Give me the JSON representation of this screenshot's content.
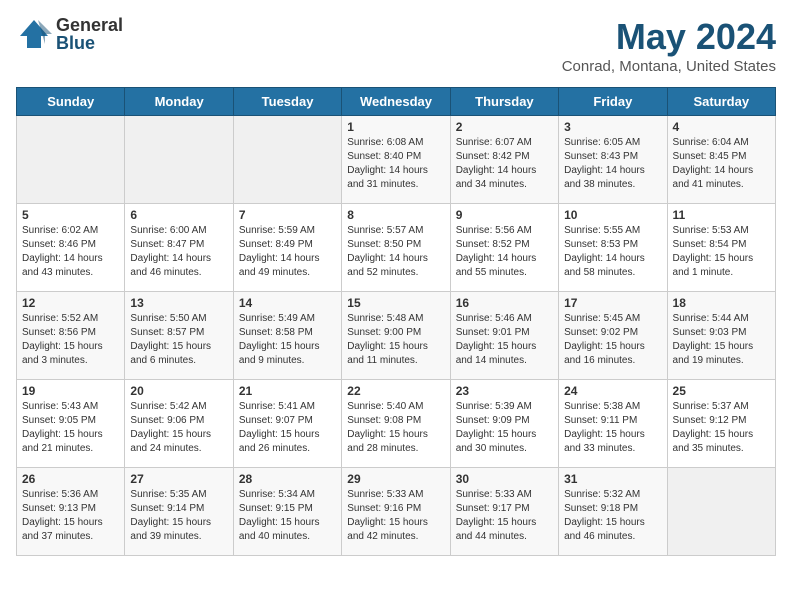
{
  "logo": {
    "general": "General",
    "blue": "Blue"
  },
  "title": "May 2024",
  "subtitle": "Conrad, Montana, United States",
  "days_header": [
    "Sunday",
    "Monday",
    "Tuesday",
    "Wednesday",
    "Thursday",
    "Friday",
    "Saturday"
  ],
  "weeks": [
    [
      {
        "num": "",
        "info": ""
      },
      {
        "num": "",
        "info": ""
      },
      {
        "num": "",
        "info": ""
      },
      {
        "num": "1",
        "info": "Sunrise: 6:08 AM\nSunset: 8:40 PM\nDaylight: 14 hours\nand 31 minutes."
      },
      {
        "num": "2",
        "info": "Sunrise: 6:07 AM\nSunset: 8:42 PM\nDaylight: 14 hours\nand 34 minutes."
      },
      {
        "num": "3",
        "info": "Sunrise: 6:05 AM\nSunset: 8:43 PM\nDaylight: 14 hours\nand 38 minutes."
      },
      {
        "num": "4",
        "info": "Sunrise: 6:04 AM\nSunset: 8:45 PM\nDaylight: 14 hours\nand 41 minutes."
      }
    ],
    [
      {
        "num": "5",
        "info": "Sunrise: 6:02 AM\nSunset: 8:46 PM\nDaylight: 14 hours\nand 43 minutes."
      },
      {
        "num": "6",
        "info": "Sunrise: 6:00 AM\nSunset: 8:47 PM\nDaylight: 14 hours\nand 46 minutes."
      },
      {
        "num": "7",
        "info": "Sunrise: 5:59 AM\nSunset: 8:49 PM\nDaylight: 14 hours\nand 49 minutes."
      },
      {
        "num": "8",
        "info": "Sunrise: 5:57 AM\nSunset: 8:50 PM\nDaylight: 14 hours\nand 52 minutes."
      },
      {
        "num": "9",
        "info": "Sunrise: 5:56 AM\nSunset: 8:52 PM\nDaylight: 14 hours\nand 55 minutes."
      },
      {
        "num": "10",
        "info": "Sunrise: 5:55 AM\nSunset: 8:53 PM\nDaylight: 14 hours\nand 58 minutes."
      },
      {
        "num": "11",
        "info": "Sunrise: 5:53 AM\nSunset: 8:54 PM\nDaylight: 15 hours\nand 1 minute."
      }
    ],
    [
      {
        "num": "12",
        "info": "Sunrise: 5:52 AM\nSunset: 8:56 PM\nDaylight: 15 hours\nand 3 minutes."
      },
      {
        "num": "13",
        "info": "Sunrise: 5:50 AM\nSunset: 8:57 PM\nDaylight: 15 hours\nand 6 minutes."
      },
      {
        "num": "14",
        "info": "Sunrise: 5:49 AM\nSunset: 8:58 PM\nDaylight: 15 hours\nand 9 minutes."
      },
      {
        "num": "15",
        "info": "Sunrise: 5:48 AM\nSunset: 9:00 PM\nDaylight: 15 hours\nand 11 minutes."
      },
      {
        "num": "16",
        "info": "Sunrise: 5:46 AM\nSunset: 9:01 PM\nDaylight: 15 hours\nand 14 minutes."
      },
      {
        "num": "17",
        "info": "Sunrise: 5:45 AM\nSunset: 9:02 PM\nDaylight: 15 hours\nand 16 minutes."
      },
      {
        "num": "18",
        "info": "Sunrise: 5:44 AM\nSunset: 9:03 PM\nDaylight: 15 hours\nand 19 minutes."
      }
    ],
    [
      {
        "num": "19",
        "info": "Sunrise: 5:43 AM\nSunset: 9:05 PM\nDaylight: 15 hours\nand 21 minutes."
      },
      {
        "num": "20",
        "info": "Sunrise: 5:42 AM\nSunset: 9:06 PM\nDaylight: 15 hours\nand 24 minutes."
      },
      {
        "num": "21",
        "info": "Sunrise: 5:41 AM\nSunset: 9:07 PM\nDaylight: 15 hours\nand 26 minutes."
      },
      {
        "num": "22",
        "info": "Sunrise: 5:40 AM\nSunset: 9:08 PM\nDaylight: 15 hours\nand 28 minutes."
      },
      {
        "num": "23",
        "info": "Sunrise: 5:39 AM\nSunset: 9:09 PM\nDaylight: 15 hours\nand 30 minutes."
      },
      {
        "num": "24",
        "info": "Sunrise: 5:38 AM\nSunset: 9:11 PM\nDaylight: 15 hours\nand 33 minutes."
      },
      {
        "num": "25",
        "info": "Sunrise: 5:37 AM\nSunset: 9:12 PM\nDaylight: 15 hours\nand 35 minutes."
      }
    ],
    [
      {
        "num": "26",
        "info": "Sunrise: 5:36 AM\nSunset: 9:13 PM\nDaylight: 15 hours\nand 37 minutes."
      },
      {
        "num": "27",
        "info": "Sunrise: 5:35 AM\nSunset: 9:14 PM\nDaylight: 15 hours\nand 39 minutes."
      },
      {
        "num": "28",
        "info": "Sunrise: 5:34 AM\nSunset: 9:15 PM\nDaylight: 15 hours\nand 40 minutes."
      },
      {
        "num": "29",
        "info": "Sunrise: 5:33 AM\nSunset: 9:16 PM\nDaylight: 15 hours\nand 42 minutes."
      },
      {
        "num": "30",
        "info": "Sunrise: 5:33 AM\nSunset: 9:17 PM\nDaylight: 15 hours\nand 44 minutes."
      },
      {
        "num": "31",
        "info": "Sunrise: 5:32 AM\nSunset: 9:18 PM\nDaylight: 15 hours\nand 46 minutes."
      },
      {
        "num": "",
        "info": ""
      }
    ]
  ]
}
